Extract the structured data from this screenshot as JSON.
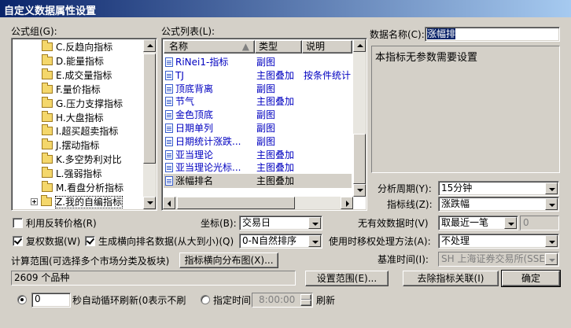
{
  "window": {
    "title": "自定义数据属性设置"
  },
  "formula_group": {
    "label": "公式组(G):",
    "items": [
      {
        "label": "C.反趋向指标"
      },
      {
        "label": "D.能量指标"
      },
      {
        "label": "E.成交量指标"
      },
      {
        "label": "F.量价指标"
      },
      {
        "label": "G.压力支撑指标"
      },
      {
        "label": "H.大盘指标"
      },
      {
        "label": "I.超买超卖指标"
      },
      {
        "label": "J.摆动指标"
      },
      {
        "label": "K.多空势利对比"
      },
      {
        "label": "L.强弱指标"
      },
      {
        "label": "M.看盘分析指标"
      },
      {
        "label": "Z.我的自编指标"
      }
    ]
  },
  "formula_list": {
    "label": "公式列表(L):",
    "headers": {
      "name": "名称",
      "type": "类型",
      "desc": "说明"
    },
    "rows": [
      {
        "name": "RiNei1-指标",
        "type": "副图",
        "desc": ""
      },
      {
        "name": "TJ",
        "type": "主图叠加",
        "desc": "按条件统计"
      },
      {
        "name": "顶底背离",
        "type": "副图",
        "desc": ""
      },
      {
        "name": "节气",
        "type": "主图叠加",
        "desc": ""
      },
      {
        "name": "金色顶底",
        "type": "副图",
        "desc": ""
      },
      {
        "name": "日期单列",
        "type": "副图",
        "desc": ""
      },
      {
        "name": "日期统计涨跌...",
        "type": "副图",
        "desc": ""
      },
      {
        "name": "亚当理论",
        "type": "主图叠加",
        "desc": ""
      },
      {
        "name": "亚当理论光标...",
        "type": "主图叠加",
        "desc": ""
      },
      {
        "name": "涨幅排名",
        "type": "主图叠加",
        "desc": ""
      }
    ]
  },
  "data_name": {
    "label": "数据名称(C):",
    "value": "涨幅排"
  },
  "description_text": "本指标无参数需要设置",
  "period": {
    "label": "分析周期(Y):",
    "value": "15分钟"
  },
  "indicator_line": {
    "label": "指标线(Z):",
    "value": "涨跌幅"
  },
  "no_data_time": {
    "label": "无有效数据时(V)",
    "value": "取最近一笔",
    "extra": "0"
  },
  "time_shift": {
    "label": "使用时移权处理方法(A):",
    "value": "不处理"
  },
  "base_time": {
    "label": "基准时间(I):",
    "value": "SH 上海证券交易所(SSE)"
  },
  "coord": {
    "label": "坐标(B):",
    "value": "交易日"
  },
  "reverse_price": {
    "label": "利用反转价格(R)",
    "checked": false
  },
  "restore_data": {
    "label": "复权数据(W)",
    "checked": true
  },
  "horizontal_rank": {
    "label": "生成横向排名数据(从大到小)(Q)",
    "checked": true,
    "value": "0-N自然排序"
  },
  "calc_range": {
    "label": "计算范围(可选择多个市场分类及板块)",
    "count_text": "2609 个品种"
  },
  "buttons": {
    "distribution": "指标横向分布图(X)...",
    "set_range": "设置范围(E)...",
    "remove_link": "去除指标关联(I)",
    "ok": "确定"
  },
  "refresh": {
    "seconds_value": "0",
    "seconds_label": "秒自动循环刷新(0表示不刷",
    "fixed_time_label": "指定时间",
    "time_value": "8:00:00",
    "refresh_label": "刷新"
  }
}
